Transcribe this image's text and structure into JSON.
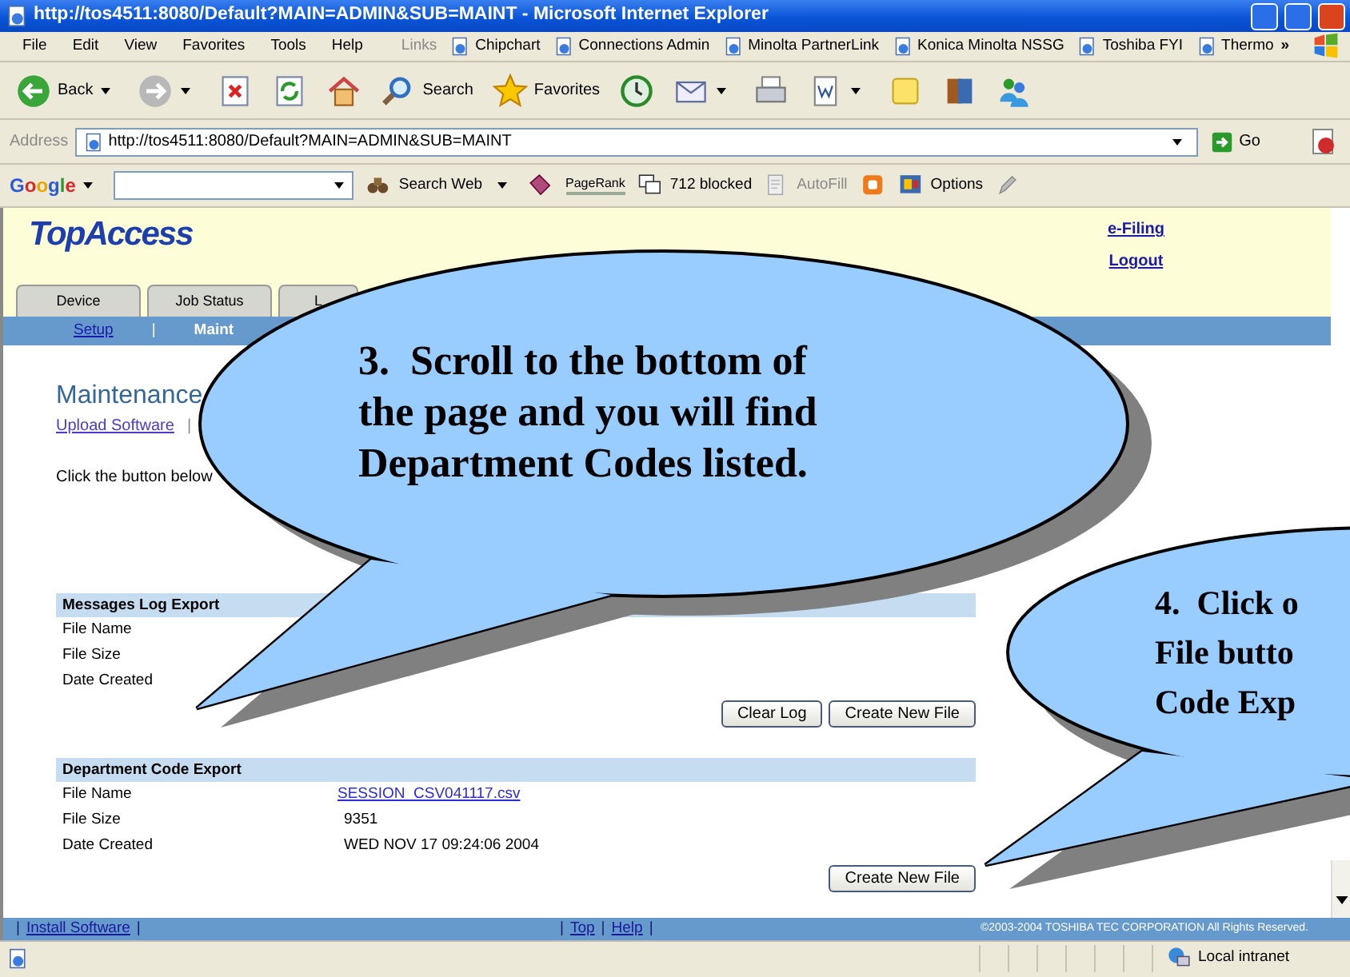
{
  "window": {
    "title": "http://tos4511:8080/Default?MAIN=ADMIN&SUB=MAINT - Microsoft Internet Explorer"
  },
  "menu": [
    "File",
    "Edit",
    "View",
    "Favorites",
    "Tools",
    "Help"
  ],
  "links": {
    "label": "Links",
    "items": [
      "Chipchart",
      "Connections Admin",
      "Minolta PartnerLink",
      "Konica Minolta NSSG",
      "Toshiba FYI",
      "Thermo"
    ],
    "more": "»"
  },
  "toolbar": [
    {
      "kind": "back",
      "label": "Back",
      "menu": true
    },
    {
      "kind": "forward",
      "menu": true
    },
    {
      "kind": "stop"
    },
    {
      "kind": "refresh"
    },
    {
      "kind": "home"
    },
    {
      "kind": "search",
      "label": "Search"
    },
    {
      "kind": "favorites",
      "label": "Favorites"
    },
    {
      "kind": "history"
    },
    {
      "kind": "mail",
      "menu": true
    },
    {
      "kind": "print"
    },
    {
      "kind": "edit",
      "menu": true
    },
    {
      "kind": "note"
    },
    {
      "kind": "research"
    },
    {
      "kind": "messenger"
    }
  ],
  "address": {
    "label": "Address",
    "value": "http://tos4511:8080/Default?MAIN=ADMIN&SUB=MAINT",
    "go": "Go"
  },
  "google": {
    "logo": "Google",
    "search": "Search Web",
    "pagerank": "PageRank",
    "blocked": "712 blocked",
    "autofill": "AutoFill",
    "options": "Options"
  },
  "page": {
    "logo": "TopAccess",
    "header_links": [
      "e-Filing",
      "Logout"
    ],
    "tabs": [
      {
        "label": "Device",
        "selected": false
      },
      {
        "label": "Job Status",
        "selected": false
      },
      {
        "label": "L",
        "selected": false
      }
    ],
    "subnav": [
      {
        "label": "Setup",
        "selected": false
      },
      {
        "label": "Maint",
        "selected": true
      }
    ],
    "subnav_separator": "|",
    "title": "Maintenance",
    "sublinks": [
      "Upload Software"
    ],
    "sublink_separator": "|",
    "instruction": "Click the button below",
    "sections": [
      {
        "title": "Messages Log Export",
        "rows": [
          {
            "label": "File Name"
          },
          {
            "label": "File Size"
          },
          {
            "label": "Date Created"
          }
        ],
        "buttons": [
          "Clear Log",
          "Create New File"
        ]
      },
      {
        "title": "Department Code Export",
        "rows": [
          {
            "label": "File Name",
            "value": "SESSION_CSV041117.csv",
            "kind": "link"
          },
          {
            "label": "File Size",
            "value": "9351",
            "kind": "text"
          },
          {
            "label": "Date Created",
            "value": "WED NOV 17 09:24:06 2004",
            "kind": "text"
          }
        ],
        "buttons": [
          "Create New File"
        ]
      }
    ],
    "footer": {
      "left": [
        {
          "kind": "sep",
          "text": "|"
        },
        {
          "kind": "link",
          "text": "Install Software"
        },
        {
          "kind": "sep",
          "text": "|"
        }
      ],
      "center": [
        {
          "kind": "sep",
          "text": "|"
        },
        {
          "kind": "link",
          "text": "Top"
        },
        {
          "kind": "sep",
          "text": "|"
        },
        {
          "kind": "link",
          "text": "Help"
        },
        {
          "kind": "sep",
          "text": "|"
        }
      ],
      "copyright": "©2003-2004 TOSHIBA TEC CORPORATION All Rights Reserved."
    }
  },
  "callouts": [
    {
      "lines": [
        "3.  Scroll to the bottom of",
        "the page and you will find",
        "Department Codes listed."
      ]
    },
    {
      "lines": [
        "4.  Click o",
        "File butto",
        "Code Exp"
      ]
    }
  ],
  "status_bar": {
    "zone": "Local intranet"
  }
}
